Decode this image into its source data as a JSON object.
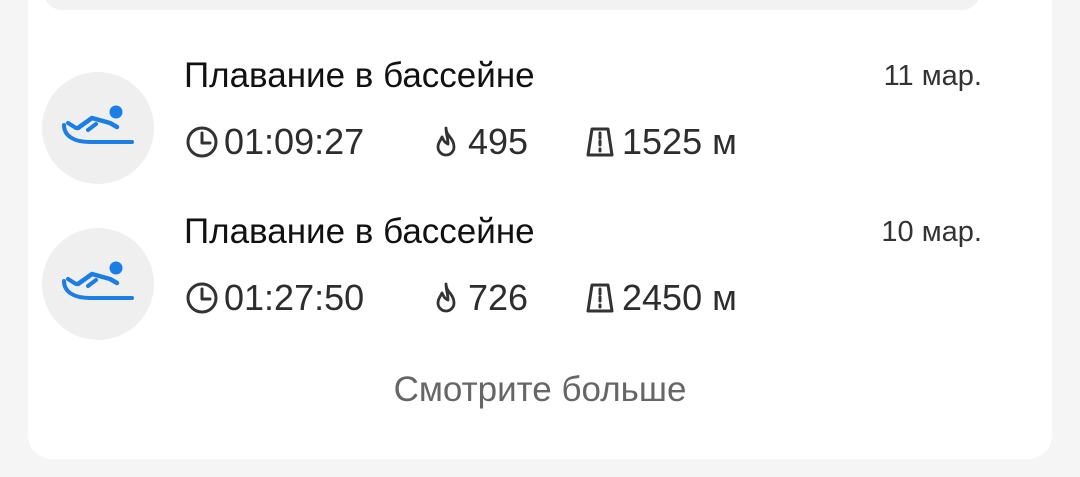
{
  "activities": [
    {
      "title": "Плавание в бассейне",
      "date": "11 мар.",
      "duration": "01:09:27",
      "calories": "495",
      "distance": "1525 м",
      "icon": "swimming-icon"
    },
    {
      "title": "Плавание в бассейне",
      "date": "10 мар.",
      "duration": "01:27:50",
      "calories": "726",
      "distance": "2450 м",
      "icon": "swimming-icon"
    }
  ],
  "see_more_label": "Смотрите больше",
  "colors": {
    "accent": "#1a7ee6",
    "avatar_bg": "#efefef",
    "text_primary": "#111111",
    "text_secondary": "#666666"
  }
}
